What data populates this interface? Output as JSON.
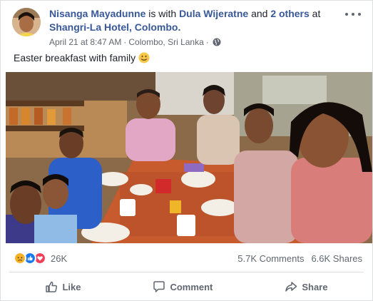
{
  "post": {
    "author": "Nisanga Mayadunne",
    "with_text": " is with ",
    "tagged": "Dula Wijeratne",
    "and_text": " and ",
    "others": "2 others",
    "at_text": " at",
    "place": "Shangri-La Hotel, Colombo.",
    "date": "April 21 at 8:47 AM",
    "sep1": " · ",
    "location": "Colombo, Sri Lanka",
    "sep2": " · ",
    "privacy_icon": "globe-icon",
    "message": "Easter breakfast with family",
    "message_emoji": "smile-emoji",
    "photo_subject": "family-breakfast-selfie-photo"
  },
  "engagement": {
    "reaction_icons": [
      "sad-reaction-icon",
      "like-reaction-icon",
      "love-reaction-icon"
    ],
    "reaction_count": "26K",
    "comments": "5.7K Comments",
    "shares": "6.6K Shares"
  },
  "actions": {
    "like": "Like",
    "comment": "Comment",
    "share": "Share"
  },
  "colors": {
    "link": "#385898",
    "muted": "#606770",
    "like_blue": "#1877f2",
    "love_red": "#f33e58",
    "sad_yellow": "#f7b125"
  }
}
